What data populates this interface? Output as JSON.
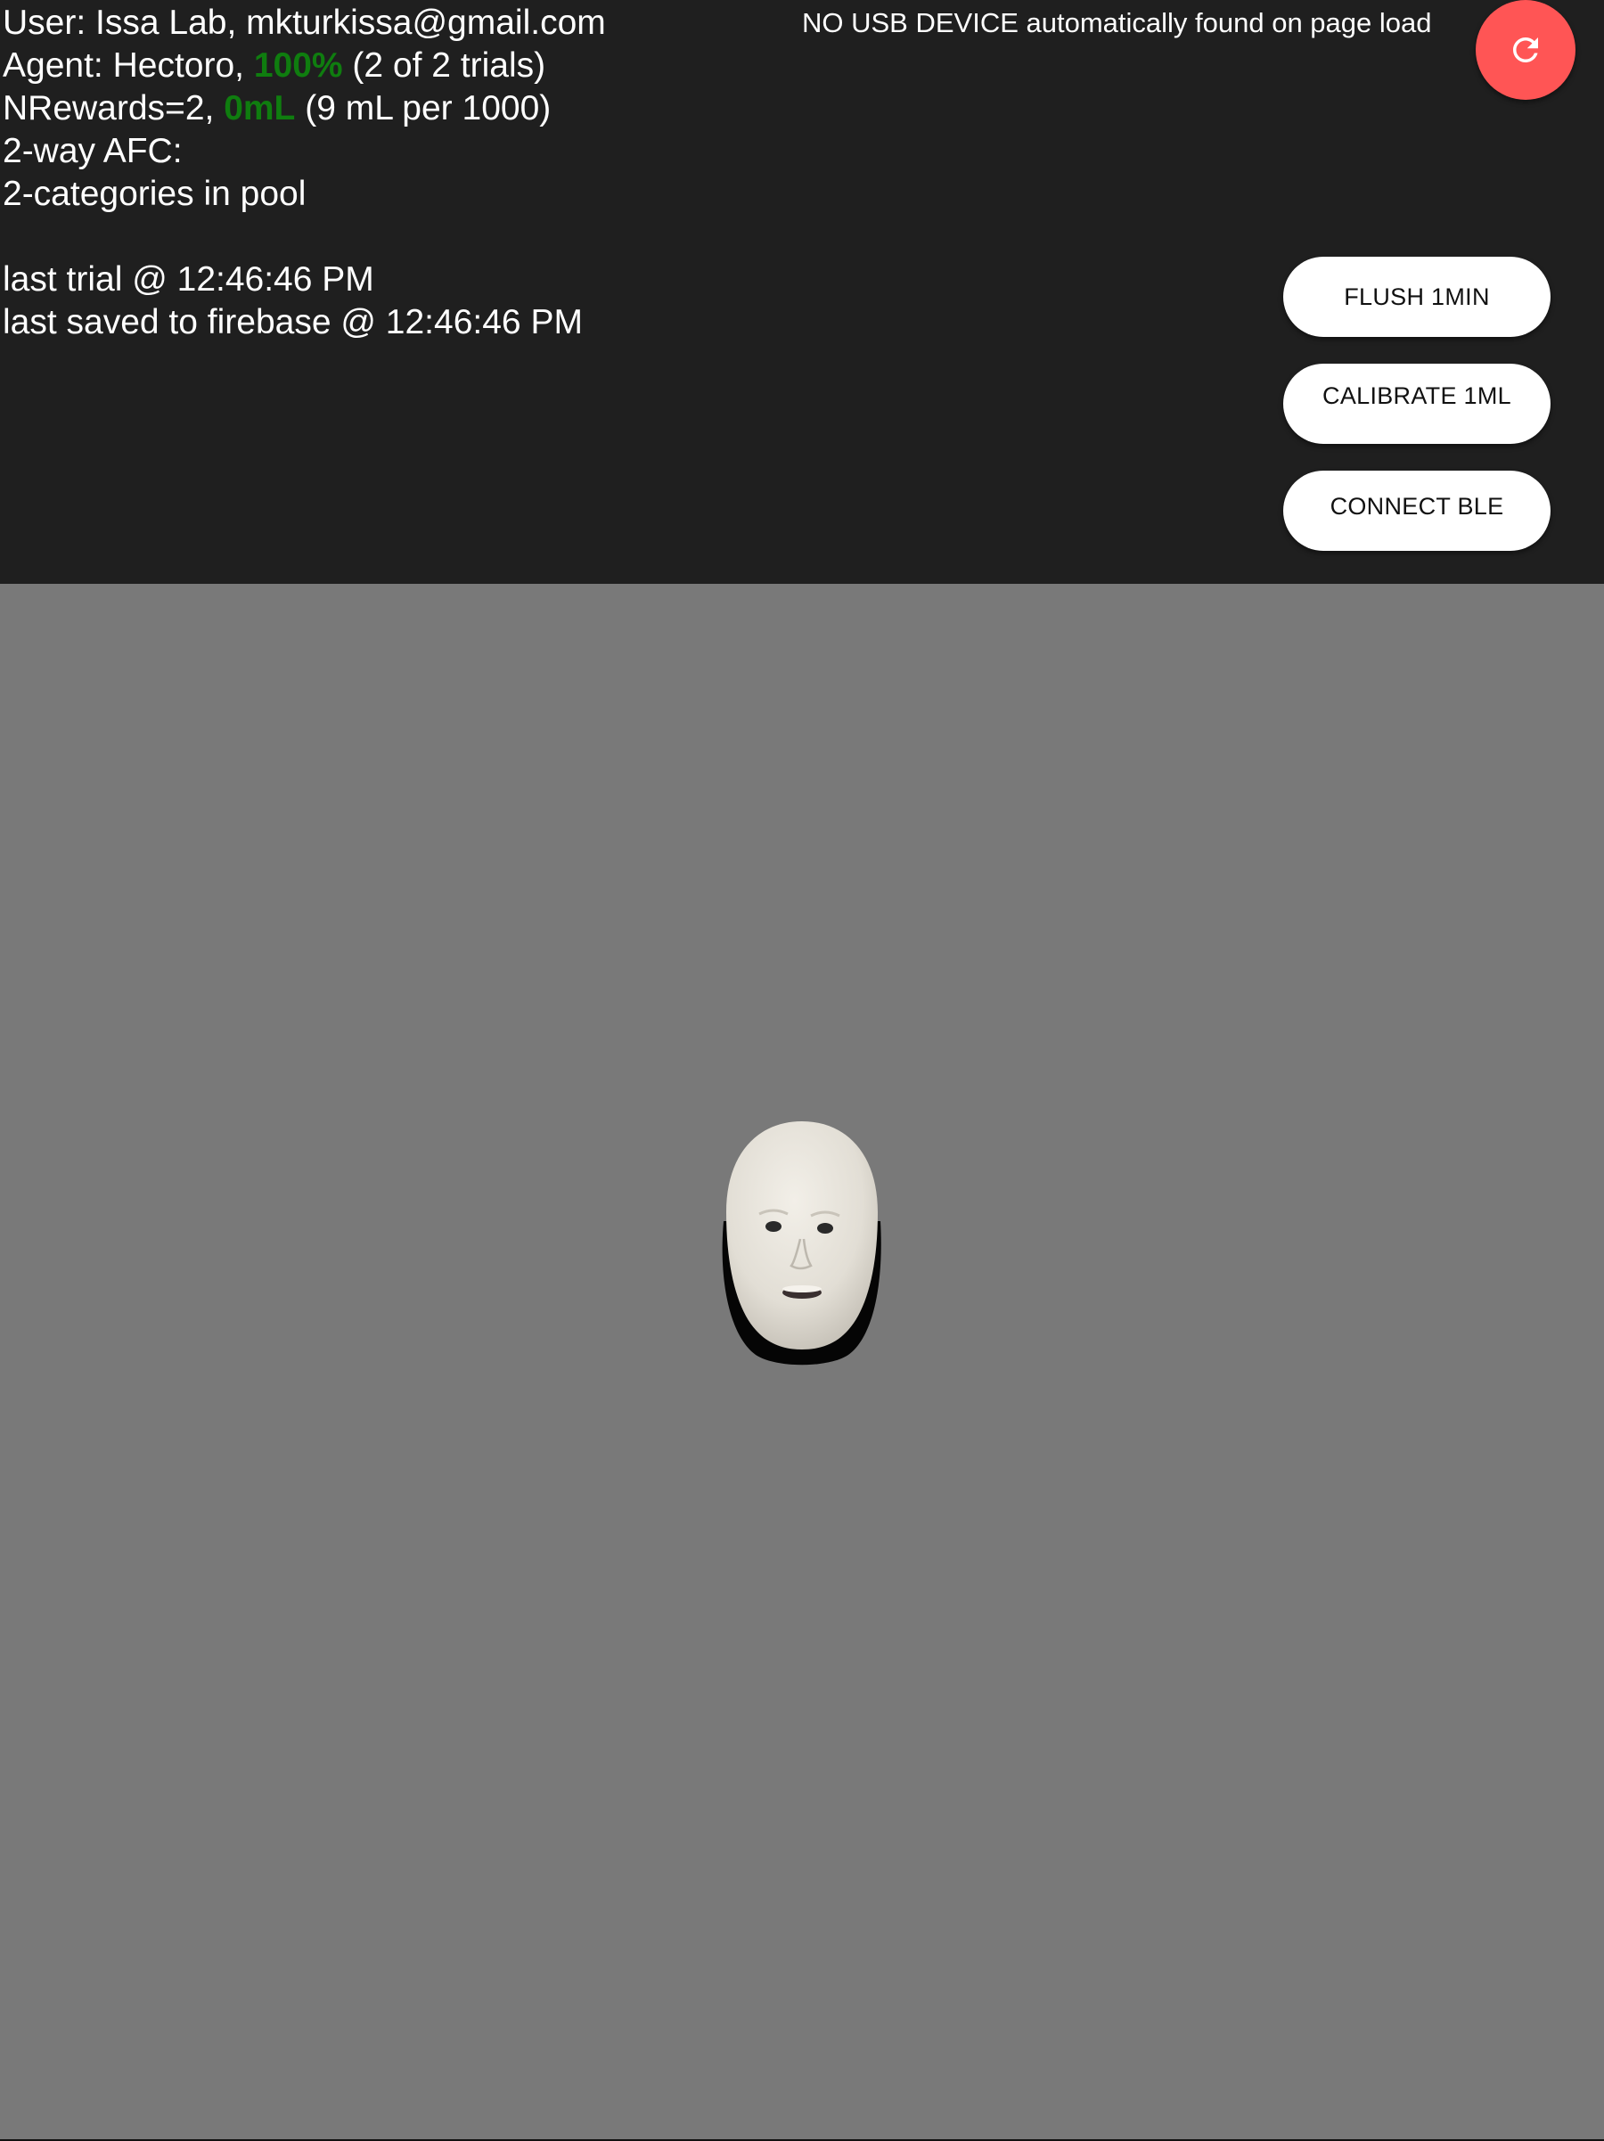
{
  "header": {
    "user_line": "User: Issa Lab, mkturkissa@gmail.com",
    "agent_prefix": "Agent: Hectoro, ",
    "agent_percent": "100%",
    "agent_suffix": " (2 of 2 trials)",
    "rewards_prefix": "NRewards=2, ",
    "rewards_volume": "0mL",
    "rewards_suffix": " (9 mL per 1000)",
    "task_line": "2-way AFC:",
    "pool_line": "2-categories in pool",
    "last_trial_line": "last trial @ 12:46:46 PM",
    "last_saved_line": "last saved to firebase @ 12:46:46 PM",
    "usb_status": "NO USB DEVICE automatically found on page load"
  },
  "buttons": {
    "refresh_icon": "refresh-icon",
    "flush_label": "FLUSH 1MIN",
    "calibrate_label": "CALIBRATE 1ML",
    "connect_label": "CONNECT BLE"
  },
  "colors": {
    "header_bg": "#1f1f1f",
    "stage_bg": "#797979",
    "accent_green": "#0f7d0f",
    "refresh_red": "#ff5555",
    "button_white": "#ffffff"
  },
  "stimulus": {
    "icon": "face-stimulus"
  }
}
